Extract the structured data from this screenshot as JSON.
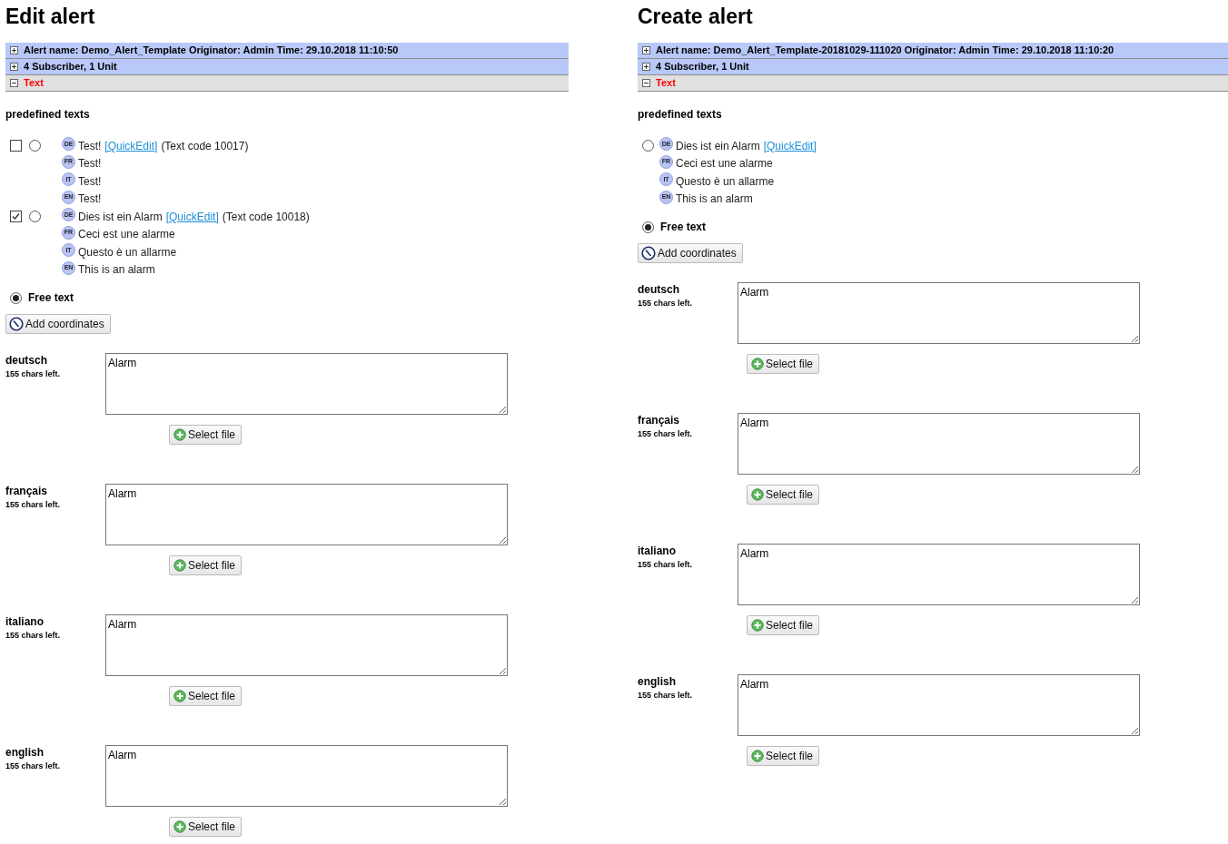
{
  "panels": [
    {
      "title": "Edit alert",
      "sections": [
        {
          "label": "Alert name: Demo_Alert_Template Originator: Admin Time: 29.10.2018 11:10:50",
          "expanded": false
        },
        {
          "label": "4 Subscriber, 1 Unit",
          "expanded": false
        },
        {
          "label": "Text",
          "expanded": true
        }
      ],
      "predefined_label": "predefined texts",
      "predefined": [
        {
          "checked": false,
          "selected": false,
          "texts": [
            {
              "lang": "DE",
              "text": "Test!",
              "link": "[QuickEdit]",
              "suffix": "(Text code 10017)"
            },
            {
              "lang": "FR",
              "text": "Test!"
            },
            {
              "lang": "IT",
              "text": "Test!"
            },
            {
              "lang": "EN",
              "text": "Test!"
            }
          ]
        },
        {
          "checked": true,
          "selected": false,
          "texts": [
            {
              "lang": "DE",
              "text": "Dies ist ein Alarm",
              "link": "[QuickEdit]",
              "suffix": "(Text code 10018)"
            },
            {
              "lang": "FR",
              "text": "Ceci est une alarme"
            },
            {
              "lang": "IT",
              "text": "Questo è un allarme"
            },
            {
              "lang": "EN",
              "text": "This is an alarm"
            }
          ]
        }
      ],
      "free_text": {
        "label": "Free text",
        "selected": true
      },
      "coordinates_button": "Add coordinates",
      "languages": [
        {
          "name": "deutsch",
          "chars_left": "155 chars left.",
          "value": "Alarm",
          "button": "Select file"
        },
        {
          "name": "français",
          "chars_left": "155 chars left.",
          "value": "Alarm",
          "button": "Select file"
        },
        {
          "name": "italiano",
          "chars_left": "155 chars left.",
          "value": "Alarm",
          "button": "Select file"
        },
        {
          "name": "english",
          "chars_left": "155 chars left.",
          "value": "Alarm",
          "button": "Select file"
        }
      ]
    },
    {
      "title": "Create alert",
      "sections": [
        {
          "label": "Alert name: Demo_Alert_Template-20181029-111020 Originator: Admin Time: 29.10.2018 11:10:20",
          "expanded": false
        },
        {
          "label": "4 Subscriber, 1 Unit",
          "expanded": false
        },
        {
          "label": "Text",
          "expanded": true
        }
      ],
      "predefined_label": "predefined texts",
      "predefined": [
        {
          "selected": false,
          "texts": [
            {
              "lang": "DE",
              "text": "Dies ist ein Alarm",
              "link": "[QuickEdit]"
            },
            {
              "lang": "FR",
              "text": "Ceci est une alarme"
            },
            {
              "lang": "IT",
              "text": "Questo è un allarme"
            },
            {
              "lang": "EN",
              "text": "This is an alarm"
            }
          ]
        }
      ],
      "free_text": {
        "label": "Free text",
        "selected": true
      },
      "coordinates_button": "Add coordinates",
      "languages": [
        {
          "name": "deutsch",
          "chars_left": "155 chars left.",
          "value": "Alarm",
          "button": "Select file"
        },
        {
          "name": "français",
          "chars_left": "155 chars left.",
          "value": "Alarm",
          "button": "Select file"
        },
        {
          "name": "italiano",
          "chars_left": "155 chars left.",
          "value": "Alarm",
          "button": "Select file"
        },
        {
          "name": "english",
          "chars_left": "155 chars left.",
          "value": "Alarm",
          "button": "Select file"
        }
      ]
    }
  ]
}
